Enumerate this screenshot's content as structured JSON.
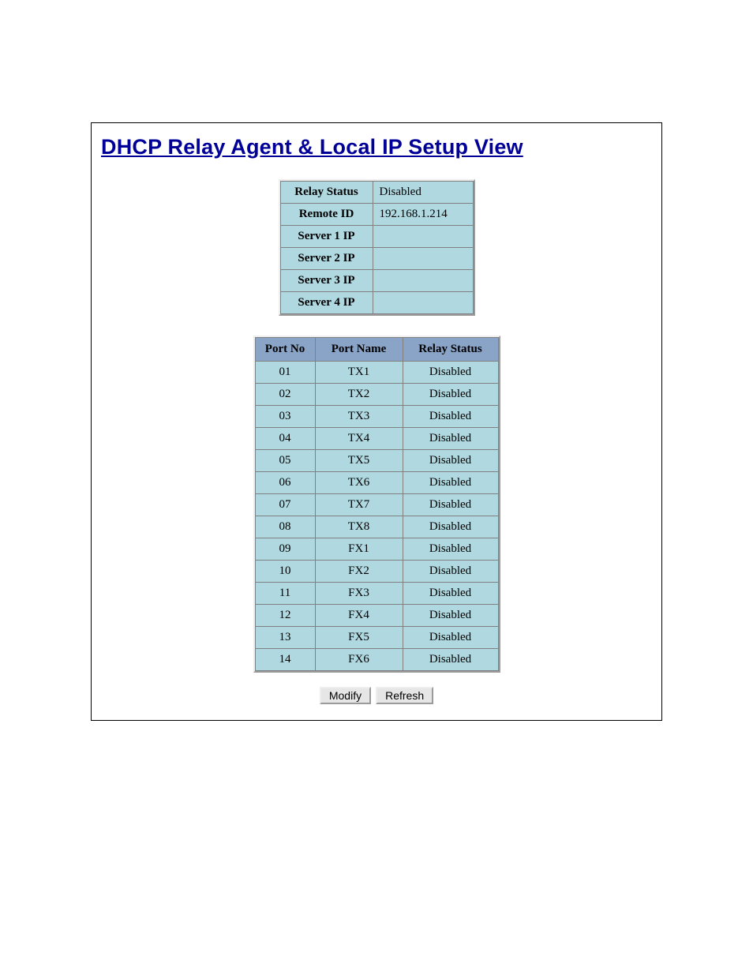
{
  "title": "DHCP Relay Agent & Local IP Setup View",
  "info": {
    "relay_status_label": "Relay Status",
    "relay_status_value": "Disabled",
    "remote_id_label": "Remote ID",
    "remote_id_value": "192.168.1.214",
    "server1_label": "Server 1 IP",
    "server1_value": "",
    "server2_label": "Server 2 IP",
    "server2_value": "",
    "server3_label": "Server 3 IP",
    "server3_value": "",
    "server4_label": "Server 4 IP",
    "server4_value": ""
  },
  "port_table": {
    "headers": {
      "no": "Port No",
      "name": "Port Name",
      "status": "Relay Status"
    },
    "rows": [
      {
        "no": "01",
        "name": "TX1",
        "status": "Disabled"
      },
      {
        "no": "02",
        "name": "TX2",
        "status": "Disabled"
      },
      {
        "no": "03",
        "name": "TX3",
        "status": "Disabled"
      },
      {
        "no": "04",
        "name": "TX4",
        "status": "Disabled"
      },
      {
        "no": "05",
        "name": "TX5",
        "status": "Disabled"
      },
      {
        "no": "06",
        "name": "TX6",
        "status": "Disabled"
      },
      {
        "no": "07",
        "name": "TX7",
        "status": "Disabled"
      },
      {
        "no": "08",
        "name": "TX8",
        "status": "Disabled"
      },
      {
        "no": "09",
        "name": "FX1",
        "status": "Disabled"
      },
      {
        "no": "10",
        "name": "FX2",
        "status": "Disabled"
      },
      {
        "no": "11",
        "name": "FX3",
        "status": "Disabled"
      },
      {
        "no": "12",
        "name": "FX4",
        "status": "Disabled"
      },
      {
        "no": "13",
        "name": "FX5",
        "status": "Disabled"
      },
      {
        "no": "14",
        "name": "FX6",
        "status": "Disabled"
      }
    ]
  },
  "buttons": {
    "modify": "Modify",
    "refresh": "Refresh"
  }
}
